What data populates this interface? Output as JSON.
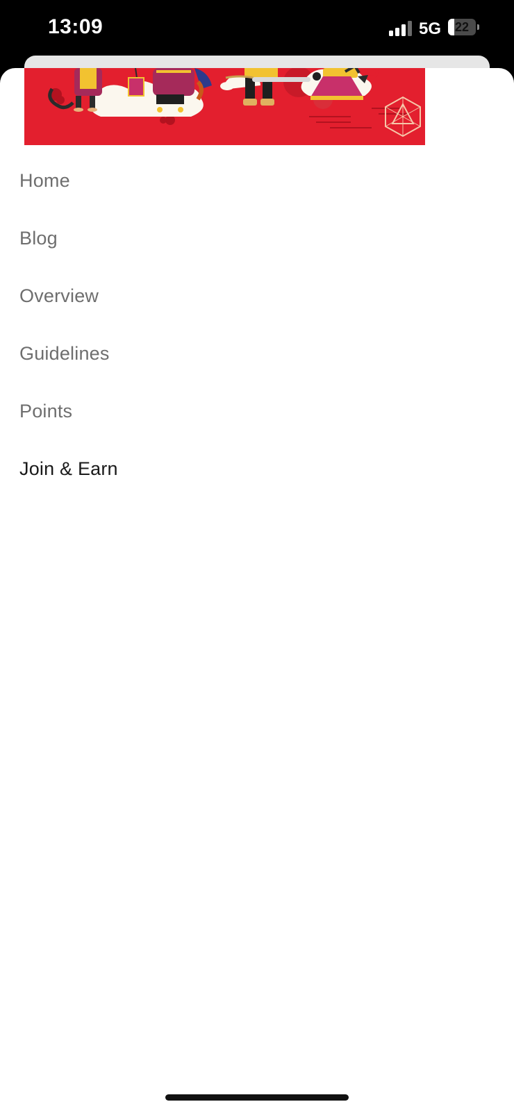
{
  "status_bar": {
    "time": "13:09",
    "network": "5G",
    "battery": "22",
    "battery_level": 0.22,
    "signal_icon": "cellular-signal-icon"
  },
  "banner": {
    "icons": [
      "illustration-characters",
      "hexagon-logo-icon"
    ],
    "background_color": "#e31f2e"
  },
  "menu": {
    "items": [
      {
        "label": "Home",
        "active": false
      },
      {
        "label": "Blog",
        "active": false
      },
      {
        "label": "Overview",
        "active": false
      },
      {
        "label": "Guidelines",
        "active": false
      },
      {
        "label": "Points",
        "active": false
      },
      {
        "label": "Join & Earn",
        "active": true
      }
    ]
  },
  "colors": {
    "menu_text": "#6e6e6e",
    "menu_text_active": "#1a1a1a"
  }
}
